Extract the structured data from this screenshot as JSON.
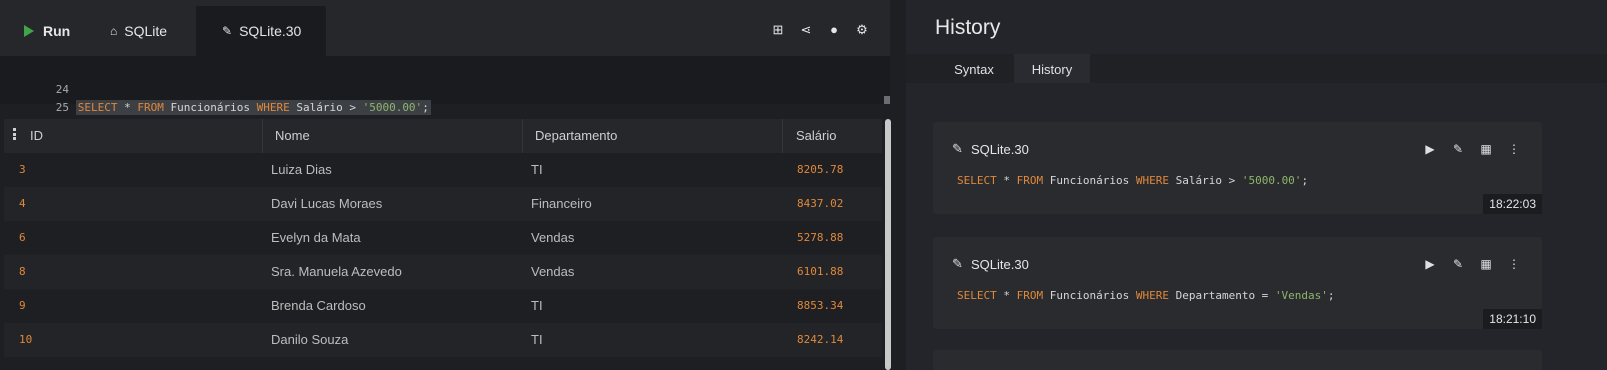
{
  "toolbar": {
    "run_label": "Run",
    "sqlite_tab_label": "SQLite",
    "active_tab_label": "SQLite.30",
    "icons": [
      "plus-square-icon",
      "share-icon",
      "user-icon",
      "gear-icon"
    ]
  },
  "editor": {
    "lines": [
      {
        "num": "24"
      },
      {
        "num": "25"
      }
    ],
    "query": {
      "kw1": "SELECT",
      "star": " * ",
      "kw2": "FROM",
      "table": " Funcionários ",
      "kw3": "WHERE",
      "cond": " Salário > ",
      "value": "'5000.00'",
      "end": ";"
    }
  },
  "grid": {
    "headers": [
      "ID",
      "Nome",
      "Departamento",
      "Salário"
    ],
    "rows": [
      [
        "3",
        "Luiza Dias",
        "TI",
        "8205.78"
      ],
      [
        "4",
        "Davi Lucas Moraes",
        "Financeiro",
        "8437.02"
      ],
      [
        "6",
        "Evelyn da Mata",
        "Vendas",
        "5278.88"
      ],
      [
        "8",
        "Sra. Manuela Azevedo",
        "Vendas",
        "6101.88"
      ],
      [
        "9",
        "Brenda Cardoso",
        "TI",
        "8853.34"
      ],
      [
        "10",
        "Danilo Souza",
        "TI",
        "8242.14"
      ]
    ]
  },
  "history": {
    "title": "History",
    "tabs": [
      "Syntax",
      "History"
    ],
    "entries": [
      {
        "name": "SQLite.30",
        "kw1": "SELECT",
        "star": " * ",
        "kw2": "FROM",
        "table": " Funcionários ",
        "kw3": "WHERE",
        "cond": " Salário > ",
        "value": "'5000.00'",
        "end": ";",
        "time": "18:22:03"
      },
      {
        "name": "SQLite.30",
        "kw1": "SELECT",
        "star": " * ",
        "kw2": "FROM",
        "table": " Funcionários ",
        "kw3": "WHERE",
        "cond": " Departamento = ",
        "value": "'Vendas'",
        "end": ";",
        "time": "18:21:10"
      }
    ]
  },
  "colors": {
    "accent_orange": "#e0883b",
    "string_green": "#8fb56c",
    "run_green": "#41a34a"
  }
}
